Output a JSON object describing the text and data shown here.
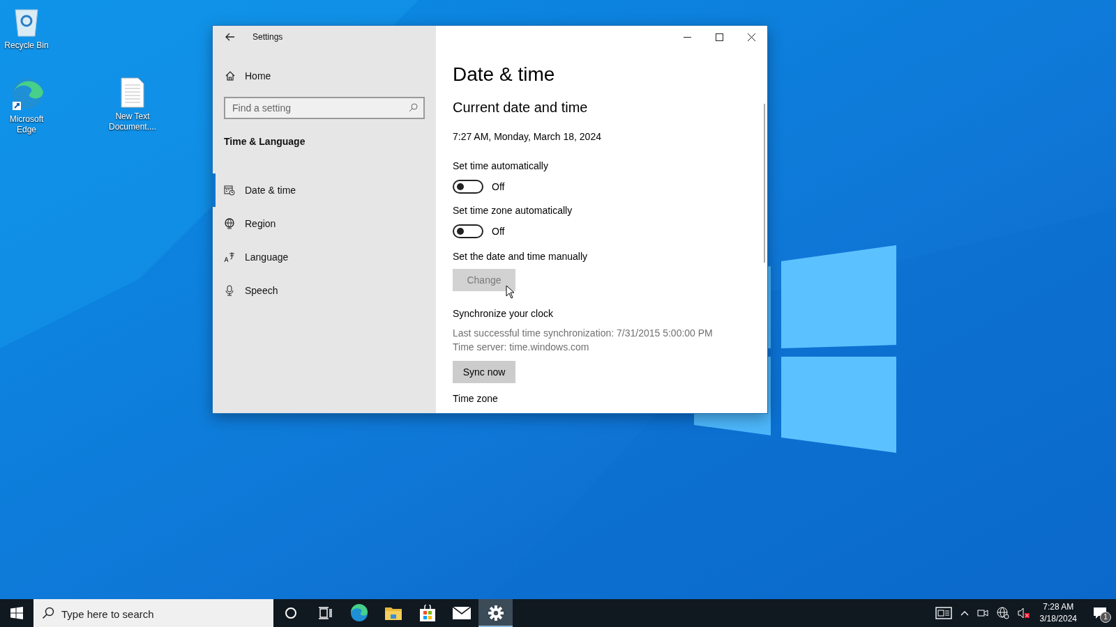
{
  "desktop_icons": [
    {
      "label": "Recycle Bin",
      "kind": "recycle"
    },
    {
      "label": "Microsoft Edge",
      "kind": "edge"
    },
    {
      "label": "New Text Document....",
      "kind": "text"
    }
  ],
  "window": {
    "title": "Settings",
    "sidebar": {
      "home": "Home",
      "search": {
        "placeholder": "Find a setting"
      },
      "section": "Time & Language",
      "items": [
        {
          "label": "Date & time",
          "kind": "datetime",
          "selected": true
        },
        {
          "label": "Region",
          "kind": "region",
          "selected": false
        },
        {
          "label": "Language",
          "kind": "language",
          "selected": false
        },
        {
          "label": "Speech",
          "kind": "speech",
          "selected": false
        }
      ]
    },
    "content": {
      "heading": "Date & time",
      "subheading": "Current date and time",
      "current": "7:27 AM, Monday, March 18, 2024",
      "toggles": [
        {
          "label": "Set time automatically",
          "on": false,
          "state_text": "Off"
        },
        {
          "label": "Set time zone automatically",
          "on": false,
          "state_text": "Off"
        }
      ],
      "manual": {
        "label": "Set the date and time manually",
        "button": {
          "label": "Change",
          "disabled": true
        }
      },
      "sync": {
        "heading": "Synchronize your clock",
        "last": "Last successful time synchronization: 7/31/2015 5:00:00 PM",
        "server": "Time server: time.windows.com",
        "button": {
          "label": "Sync now",
          "disabled": false
        }
      },
      "next_section": "Time zone"
    }
  },
  "taskbar": {
    "search": {
      "placeholder": "Type here to search"
    },
    "apps": [
      {
        "kind": "cortana",
        "selected": false
      },
      {
        "kind": "taskview",
        "selected": false
      },
      {
        "kind": "edge",
        "selected": false
      },
      {
        "kind": "explorer",
        "selected": false
      },
      {
        "kind": "store",
        "selected": false
      },
      {
        "kind": "mail",
        "selected": false
      },
      {
        "kind": "settings",
        "selected": true
      }
    ],
    "clock": {
      "time": "7:28 AM",
      "date": "3/18/2024"
    },
    "notifications": {
      "badge": "1"
    }
  }
}
